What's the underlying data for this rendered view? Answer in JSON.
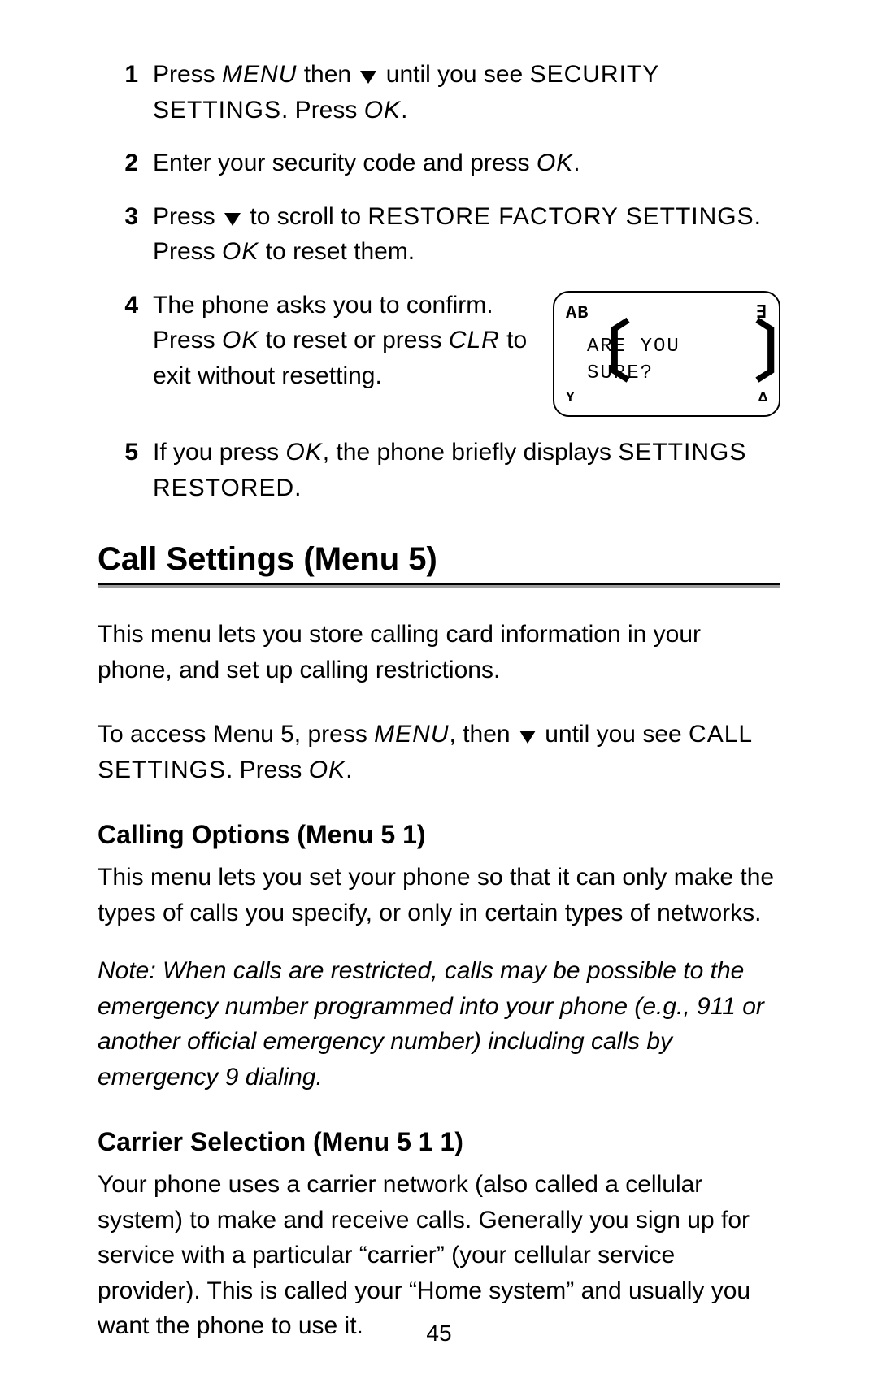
{
  "steps": [
    {
      "num": "1",
      "parts": [
        "Press ",
        "MENU",
        " then ",
        "▼",
        " until you see ",
        "SECURITY SETTINGS",
        ". Press ",
        "OK",
        "."
      ],
      "styles": [
        "",
        "italic menu-label",
        "",
        "icon",
        "",
        "menu-label",
        "",
        "italic menu-label",
        ""
      ]
    },
    {
      "num": "2",
      "parts": [
        "Enter your security code and press ",
        "OK",
        "."
      ],
      "styles": [
        "",
        "italic menu-label",
        ""
      ]
    },
    {
      "num": "3",
      "parts": [
        "Press ",
        "▼",
        " to scroll to ",
        "RESTORE FACTORY SETTINGS",
        ". Press ",
        "OK",
        " to reset them."
      ],
      "styles": [
        "",
        "icon",
        "",
        "menu-label",
        "",
        "italic menu-label",
        ""
      ]
    },
    {
      "num": "4",
      "parts": [
        "The phone asks you to confirm. Press ",
        "OK",
        " to reset or press ",
        "CLR",
        " to exit without resetting."
      ],
      "styles": [
        "",
        "italic menu-label",
        "",
        "italic menu-label",
        ""
      ]
    },
    {
      "num": "5",
      "parts": [
        "If you press ",
        "OK",
        ", the phone briefly displays ",
        "SETTINGS RESTORED",
        "."
      ],
      "styles": [
        "",
        "italic menu-label",
        "",
        "menu-label",
        ""
      ]
    }
  ],
  "screen": {
    "top_left": "AB",
    "top_right": "∃",
    "line1": "ARE YOU",
    "line2": "SURE?",
    "bot_left": "Y",
    "bot_right": "∆"
  },
  "h1": "Call Settings (Menu 5)",
  "intro1": "This menu lets you store calling card information in your phone, and set up calling restrictions.",
  "intro2_parts": [
    "To access Menu 5, press ",
    "MENU",
    ", then ",
    "▼",
    " until you see ",
    "CALL SETTINGS",
    ". Press ",
    "OK",
    "."
  ],
  "intro2_styles": [
    "",
    "italic menu-label",
    "",
    "icon",
    "",
    "menu-label",
    "",
    "italic menu-label",
    ""
  ],
  "h2a": "Calling Options (Menu 5 1)",
  "p2a": "This menu lets you set your phone so that it can only make the types of calls you specify, or only in certain types of networks.",
  "note": "Note: When calls are restricted, calls may be possible to the emergency number programmed into your phone (e.g., 911 or another official emergency number) including calls by emergency 9 dialing.",
  "h2b": "Carrier Selection (Menu 5 1 1)",
  "p2b": "Your phone uses a carrier network (also called a cellular system) to make and receive calls. Generally you sign up for service with a particular “carrier” (your cellular service provider). This is called your “Home system” and usually you want the phone to use it.",
  "page_num": "45"
}
